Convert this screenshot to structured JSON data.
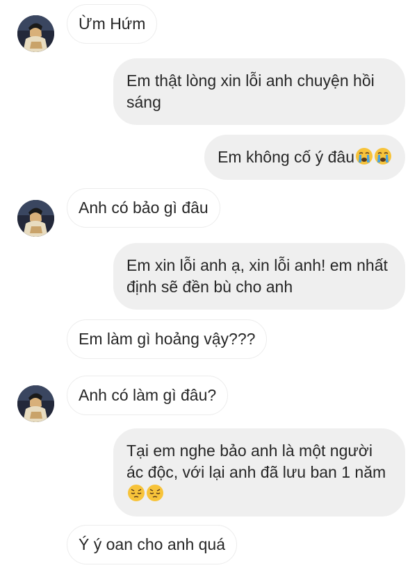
{
  "messages": [
    {
      "side": "in",
      "text": "Ừm Hứm"
    },
    {
      "side": "out",
      "text": "Em thật lòng xin lỗi anh chuyện hồi sáng"
    },
    {
      "side": "out",
      "text": "Em không cố ý đâu",
      "emoji": [
        "crying-face",
        "crying-face"
      ]
    },
    {
      "side": "in",
      "text": "Anh có bảo gì đâu"
    },
    {
      "side": "out",
      "text": "Em xin lỗi anh ạ, xin lỗi anh! em nhất định sẽ đền bù cho anh"
    },
    {
      "side": "in",
      "text": "Em làm gì hoảng vậy???"
    },
    {
      "side": "in",
      "text": "Anh có làm gì đâu?"
    },
    {
      "side": "out",
      "text": "Tại em nghe bảo anh là một người ác độc, với lại anh đã lưu ban 1 năm",
      "emoji": [
        "pensive-face",
        "pensive-face"
      ]
    },
    {
      "side": "in",
      "text": "Ý ý oan cho anh quá"
    }
  ],
  "colors": {
    "incoming_bubble": "#ffffff",
    "incoming_border": "#ececec",
    "outgoing_bubble": "#efefef",
    "text": "#262626",
    "emoji_yellow": "#f7c33a"
  },
  "icons": {
    "avatar": "contact-avatar-photo",
    "crying": "crying-face-emoji",
    "pensive": "pensive-face-emoji"
  }
}
